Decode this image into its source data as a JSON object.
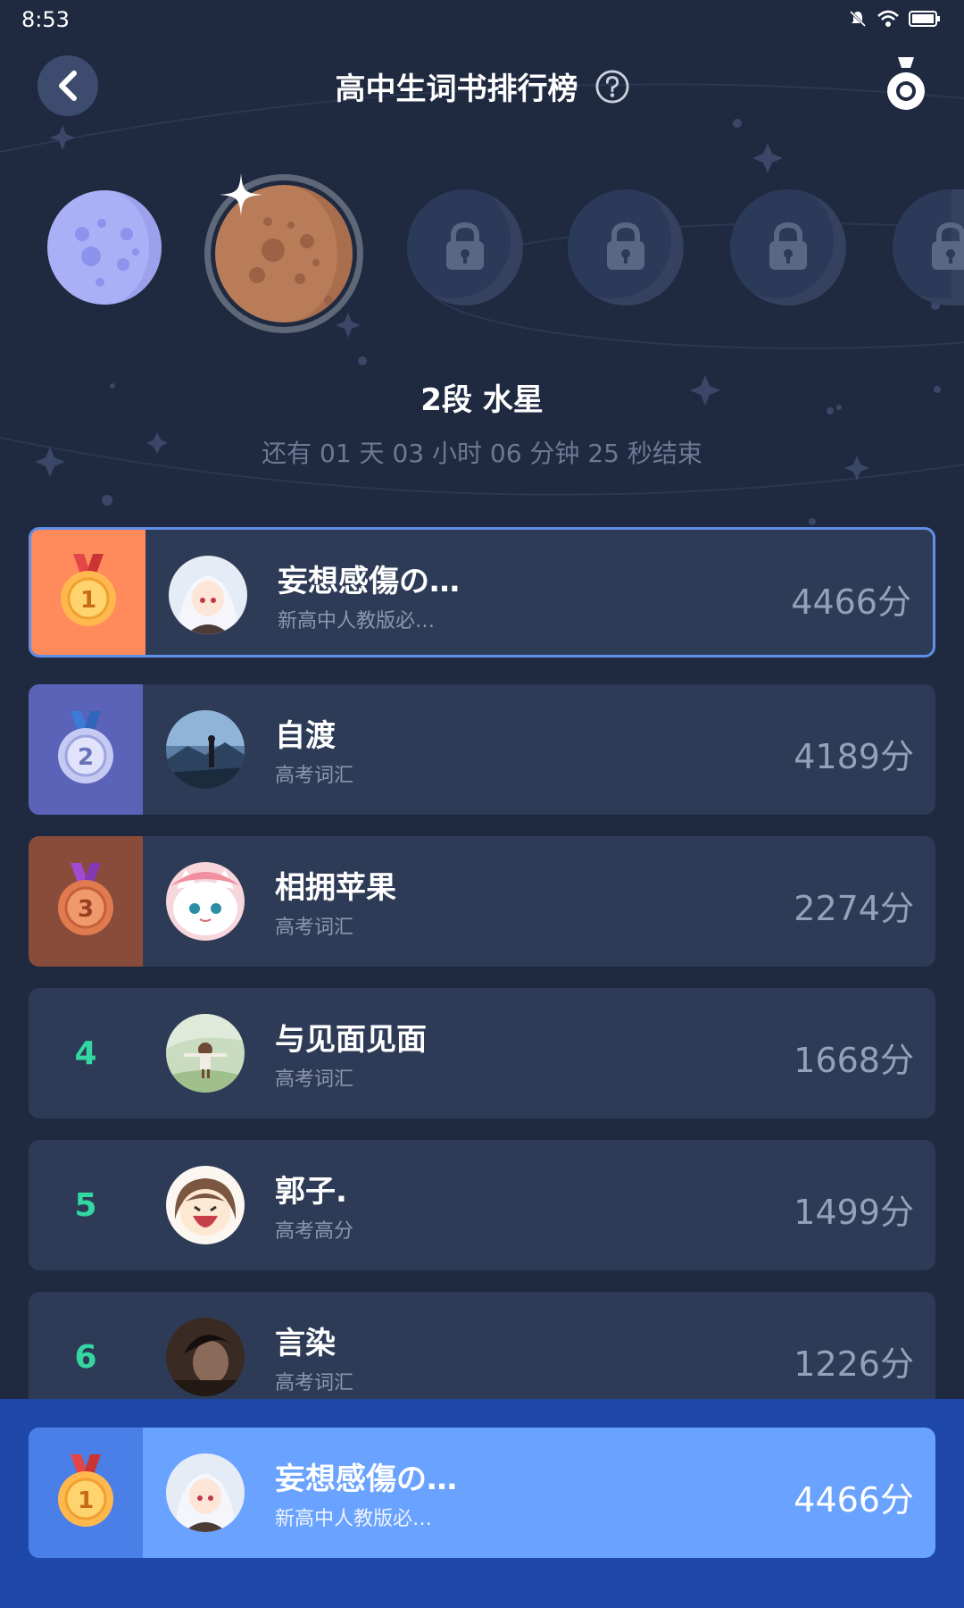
{
  "status_bar": {
    "time": "8:53"
  },
  "header": {
    "title": "高中生词书排行榜"
  },
  "level": {
    "name": "2段 水星",
    "countdown": "还有 01 天 03 小时 06 分钟 25 秒结束"
  },
  "leaderboard": [
    {
      "rank": "1",
      "name": "妄想感傷の…",
      "book": "新高中人教版必…",
      "score": "4466分"
    },
    {
      "rank": "2",
      "name": "自渡",
      "book": "高考词汇",
      "score": "4189分"
    },
    {
      "rank": "3",
      "name": "相拥苹果",
      "book": "高考词汇",
      "score": "2274分"
    },
    {
      "rank": "4",
      "name": "与见面见面",
      "book": "高考词汇",
      "score": "1668分"
    },
    {
      "rank": "5",
      "name": "郭子.",
      "book": "高考高分",
      "score": "1499分"
    },
    {
      "rank": "6",
      "name": "言染",
      "book": "高考词汇",
      "score": "1226分"
    }
  ],
  "my_rank": {
    "rank": "1",
    "name": "妄想感傷の…",
    "book": "新高中人教版必…",
    "score": "4466分"
  },
  "colors": {
    "background": "#1f2a40",
    "row": "#2e3b57",
    "gold": "#ff8a5b",
    "silver": "#5a63b8",
    "bronze": "#8a4c3a",
    "rank_text": "#34d7a2",
    "my_row": "#69a2ff"
  }
}
